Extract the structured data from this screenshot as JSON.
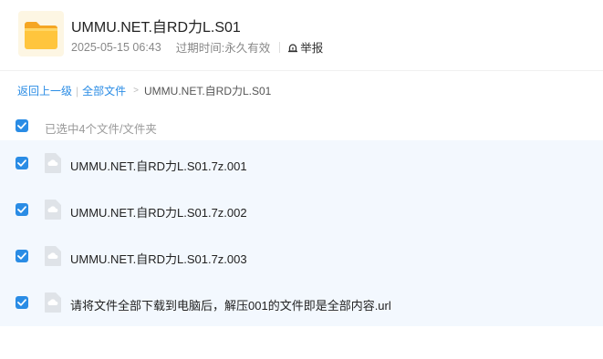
{
  "header": {
    "title": "UMMU.NET.自RD力L.S01",
    "date": "2025-05-15 06:43",
    "expire_label": "过期时间:",
    "expire_value": "永久有效",
    "report_label": "举报"
  },
  "breadcrumb": {
    "back": "返回上一级",
    "separator": "|",
    "all_files": "全部文件",
    "arrow": ">",
    "current": "UMMU.NET.自RD力L.S01"
  },
  "selection": {
    "checked": true,
    "text": "已选中4个文件/文件夹"
  },
  "files": [
    {
      "name": "UMMU.NET.自RD力L.S01.7z.001",
      "checked": true
    },
    {
      "name": "UMMU.NET.自RD力L.S01.7z.002",
      "checked": true
    },
    {
      "name": "UMMU.NET.自RD力L.S01.7z.003",
      "checked": true
    },
    {
      "name": "请将文件全部下载到电脑后，解压001的文件即是全部内容.url",
      "checked": true
    }
  ],
  "colors": {
    "accent": "#2a8ce5",
    "selected_row_bg": "#f3f8fe",
    "folder_yellow": "#ffc53d"
  },
  "icons": {
    "folder": "folder-icon",
    "report": "alarm-icon",
    "checkbox": "checkmark-icon",
    "file": "cloud-file-icon"
  }
}
